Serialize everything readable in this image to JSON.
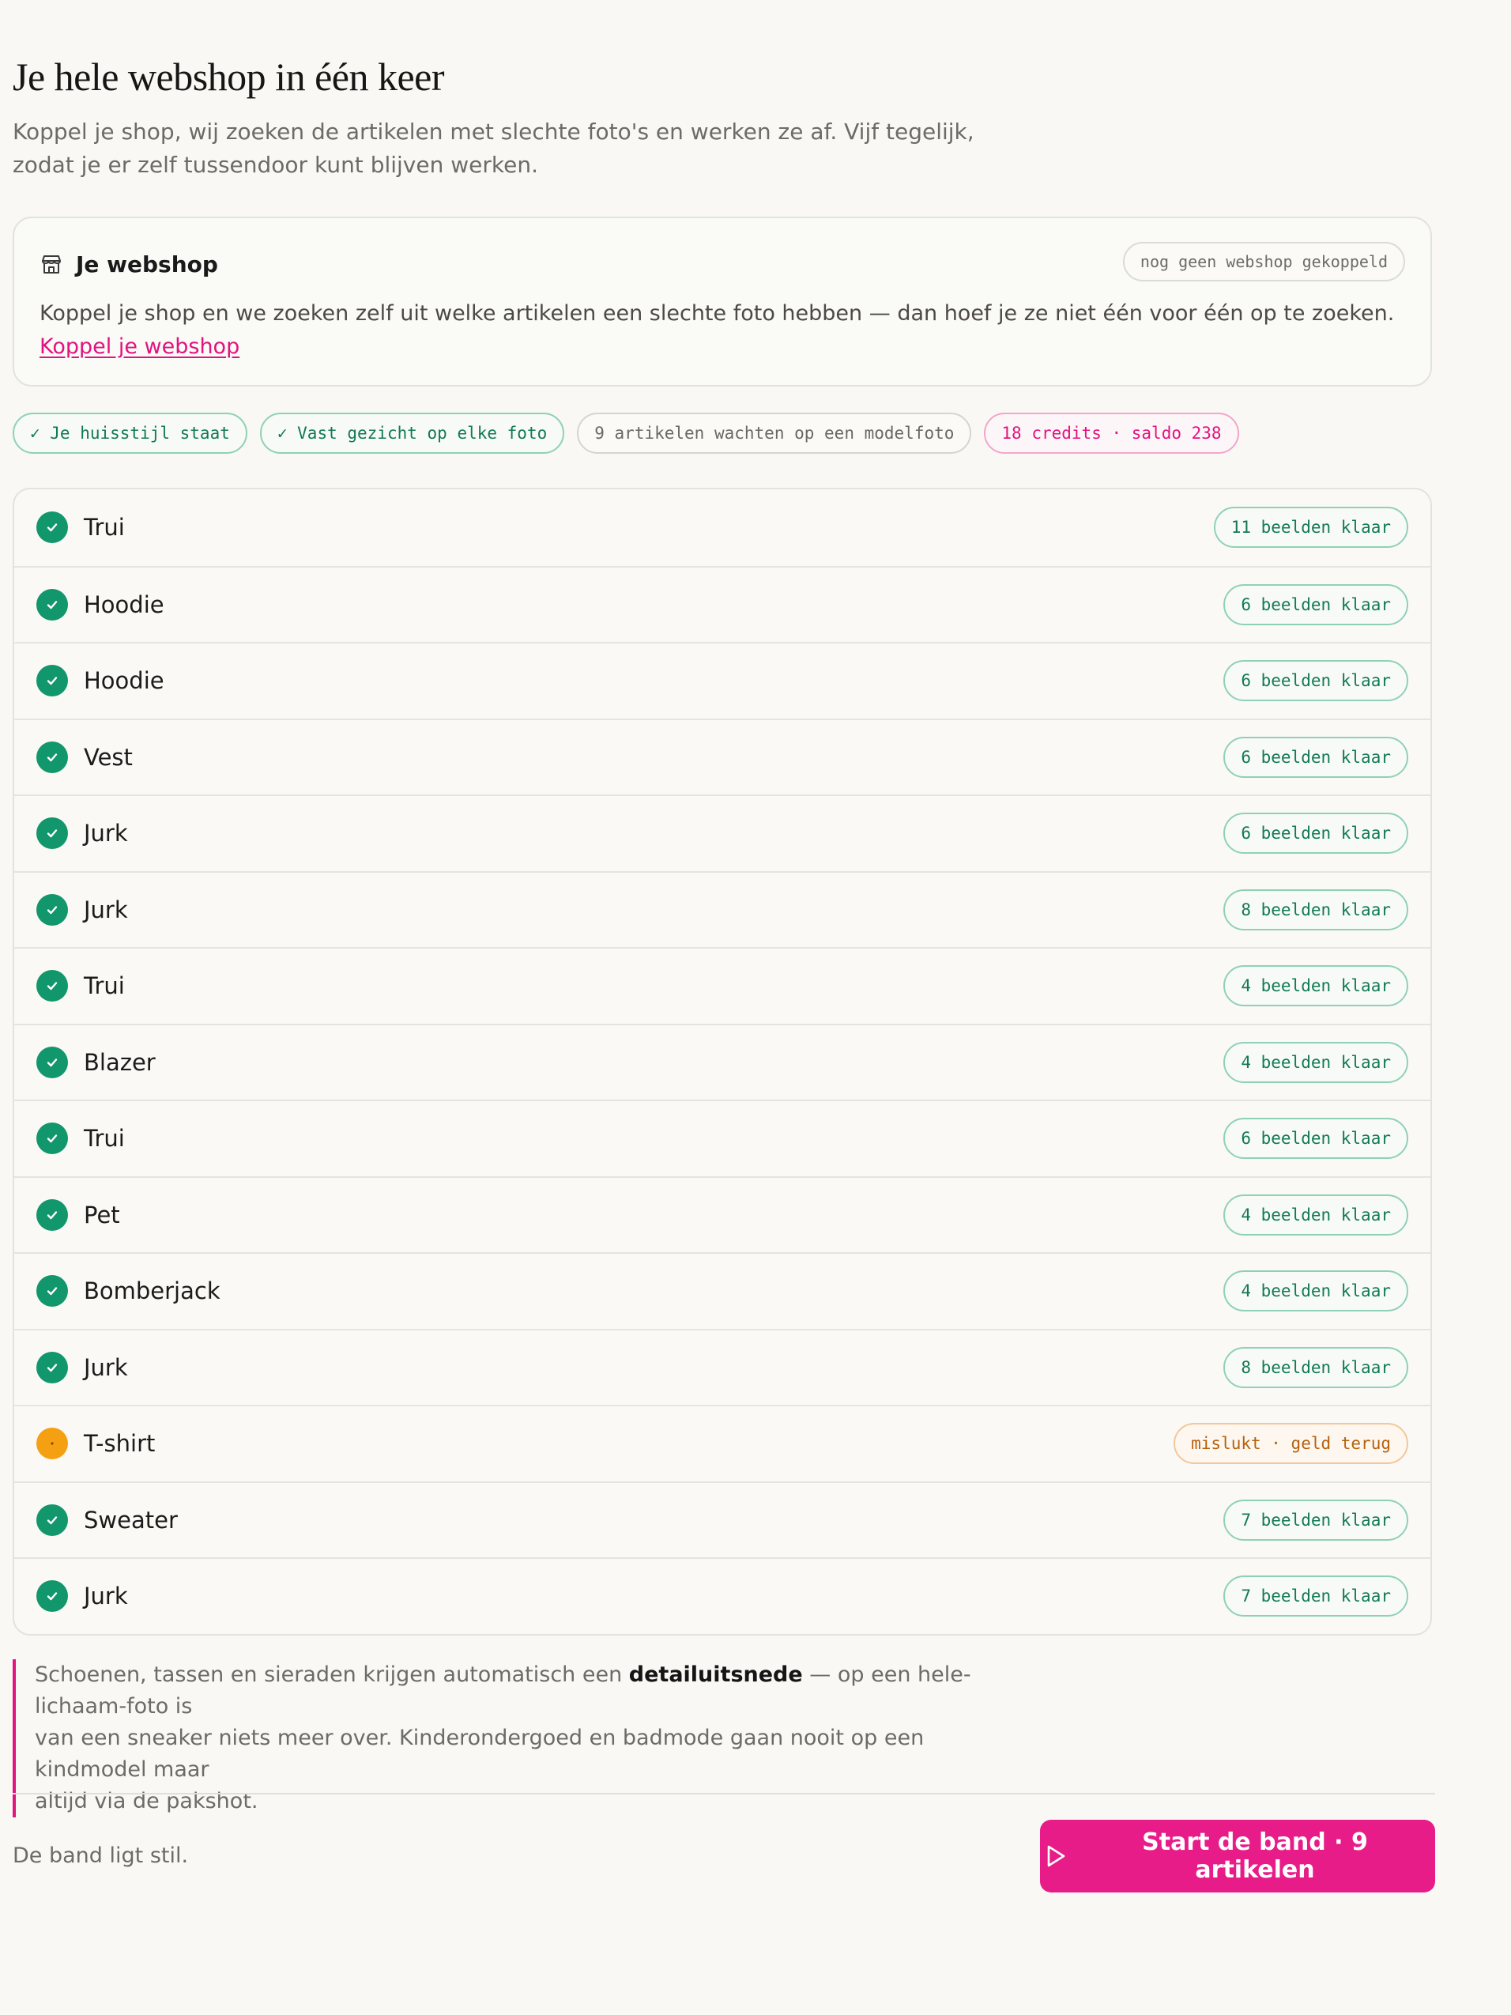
{
  "header": {
    "title": "Je hele webshop in één keer",
    "intro_line1": "Koppel je shop, wij zoeken de artikelen met slechte foto's en werken ze af. Vijf tegelijk,",
    "intro_line2": "zodat je er zelf tussendoor kunt blijven werken."
  },
  "webshop_card": {
    "icon": "store-icon",
    "title": "Je webshop",
    "status_pill": "nog geen webshop gekoppeld",
    "text": "Koppel je shop en we zoeken zelf uit welke artikelen een slechte foto hebben — dan hoef je ze niet één voor één op te zoeken. ",
    "link_label": "Koppel je webshop"
  },
  "chips": [
    {
      "label": "✓ Je huisstijl staat",
      "tone": "ok"
    },
    {
      "label": "✓ Vast gezicht op elke foto",
      "tone": "ok"
    },
    {
      "label": "9 artikelen wachten op een modelfoto",
      "tone": "neutral"
    },
    {
      "label": "18 credits · saldo 238",
      "tone": "pink"
    }
  ],
  "articles": [
    {
      "name": "Trui",
      "status": "done",
      "badge": "11 beelden klaar"
    },
    {
      "name": "Hoodie",
      "status": "done",
      "badge": "6 beelden klaar"
    },
    {
      "name": "Hoodie",
      "status": "done",
      "badge": "6 beelden klaar"
    },
    {
      "name": "Vest",
      "status": "done",
      "badge": "6 beelden klaar"
    },
    {
      "name": "Jurk",
      "status": "done",
      "badge": "6 beelden klaar"
    },
    {
      "name": "Jurk",
      "status": "done",
      "badge": "8 beelden klaar"
    },
    {
      "name": "Trui",
      "status": "done",
      "badge": "4 beelden klaar"
    },
    {
      "name": "Blazer",
      "status": "done",
      "badge": "4 beelden klaar"
    },
    {
      "name": "Trui",
      "status": "done",
      "badge": "6 beelden klaar"
    },
    {
      "name": "Pet",
      "status": "done",
      "badge": "4 beelden klaar"
    },
    {
      "name": "Bomberjack",
      "status": "done",
      "badge": "4 beelden klaar"
    },
    {
      "name": "Jurk",
      "status": "done",
      "badge": "8 beelden klaar"
    },
    {
      "name": "T-shirt",
      "status": "failed",
      "badge": "mislukt · geld terug"
    },
    {
      "name": "Sweater",
      "status": "done",
      "badge": "7 beelden klaar"
    },
    {
      "name": "Jurk",
      "status": "done",
      "badge": "7 beelden klaar"
    }
  ],
  "note": {
    "before": "Schoenen, tassen en sieraden krijgen automatisch een ",
    "bold": "detailuitsnede",
    "after_line1": " — op een hele-lichaam-foto is",
    "line2": "van een sneaker niets meer over. Kinderondergoed en badmode gaan nooit op een kindmodel maar",
    "line3": "altijd via de pakshot."
  },
  "footer": {
    "status": "De band ligt stil.",
    "start_button": "Start de band · 9 artikelen",
    "start_icon": "play-icon"
  },
  "colors": {
    "accent_pink": "#e71c89",
    "success_green": "#12966b",
    "warning_orange": "#f4a012",
    "background": "#f9f8f4"
  }
}
